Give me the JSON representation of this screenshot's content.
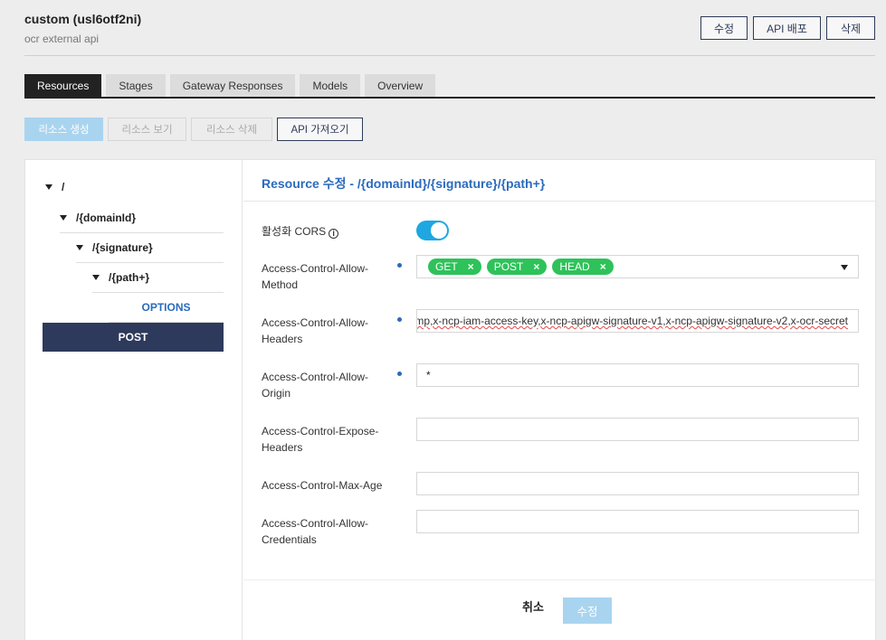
{
  "header": {
    "title": "custom (usl6otf2ni)",
    "subtitle": "ocr external api",
    "buttons": {
      "edit": "수정",
      "deploy": "API 배포",
      "delete": "삭제"
    }
  },
  "tabs": [
    "Resources",
    "Stages",
    "Gateway Responses",
    "Models",
    "Overview"
  ],
  "active_tab": "Resources",
  "actions": {
    "create": "리소스 생성",
    "view": "리소스 보기",
    "delete": "리소스 삭제",
    "import": "API 가져오기"
  },
  "tree": {
    "root": "/",
    "domain": "/{domainId}",
    "signature": "/{signature}",
    "path": "/{path+}",
    "methods": [
      "OPTIONS",
      "POST"
    ],
    "selected": "POST"
  },
  "form": {
    "title": "Resource 수정 - /{domainId}/{signature}/{path+}",
    "cors_label": "활성화 CORS",
    "cors_enabled": true,
    "allow_methods_label": "Access-Control-Allow-Method",
    "allow_methods": [
      "GET",
      "POST",
      "HEAD"
    ],
    "chip_remove": "×",
    "allow_headers_label": "Access-Control-Allow-Headers",
    "allow_headers_value": "mp,x-ncp-iam-access-key,x-ncp-apigw-signature-v1,x-ncp-apigw-signature-v2,x-ocr-secret",
    "allow_origin_label": "Access-Control-Allow-Origin",
    "allow_origin_value": "*",
    "expose_headers_label": "Access-Control-Expose-Headers",
    "expose_headers_value": "",
    "max_age_label": "Access-Control-Max-Age",
    "max_age_value": "",
    "allow_credentials_label": "Access-Control-Allow-Credentials",
    "allow_credentials_value": ""
  },
  "footer": {
    "cancel": "취소",
    "save": "수정"
  },
  "colors": {
    "accent": "#2a6bbd",
    "toggle": "#1ea7e1",
    "chip": "#2ec25a",
    "selected_row": "#2e3a5c",
    "disabled_primary": "#a9d4ef"
  }
}
